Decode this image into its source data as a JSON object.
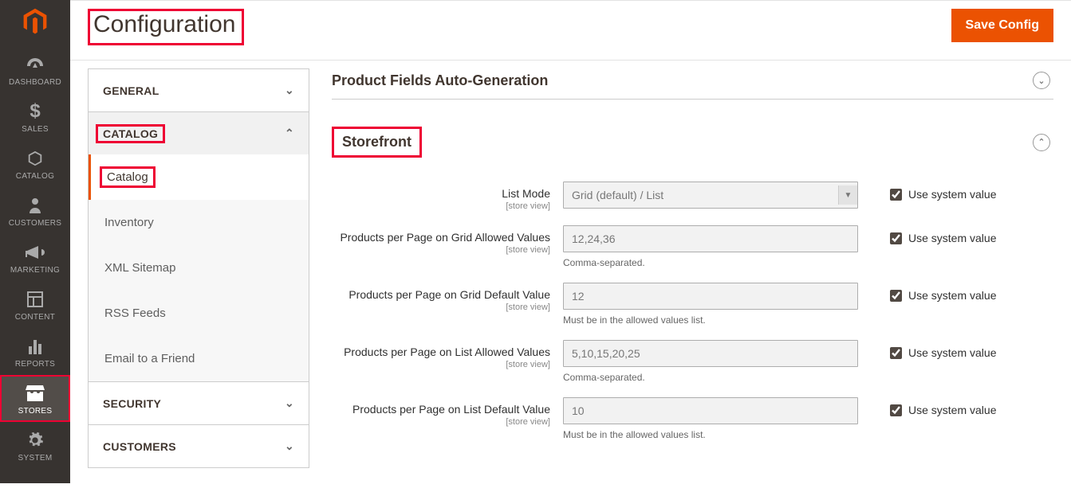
{
  "page": {
    "title": "Configuration",
    "save_label": "Save Config"
  },
  "admin_nav": {
    "items": [
      {
        "label": "DASHBOARD",
        "icon": "gauge"
      },
      {
        "label": "SALES",
        "icon": "dollar"
      },
      {
        "label": "CATALOG",
        "icon": "cube"
      },
      {
        "label": "CUSTOMERS",
        "icon": "person"
      },
      {
        "label": "MARKETING",
        "icon": "megaphone"
      },
      {
        "label": "CONTENT",
        "icon": "layout"
      },
      {
        "label": "REPORTS",
        "icon": "bars"
      },
      {
        "label": "STORES",
        "icon": "store"
      },
      {
        "label": "SYSTEM",
        "icon": "gear"
      }
    ]
  },
  "config_nav": {
    "sections": {
      "general": {
        "label": "GENERAL"
      },
      "catalog": {
        "label": "CATALOG",
        "items": [
          {
            "label": "Catalog"
          },
          {
            "label": "Inventory"
          },
          {
            "label": "XML Sitemap"
          },
          {
            "label": "RSS Feeds"
          },
          {
            "label": "Email to a Friend"
          }
        ]
      },
      "security": {
        "label": "SECURITY"
      },
      "customers": {
        "label": "CUSTOMERS"
      }
    }
  },
  "fieldsets": {
    "product_fields": {
      "title": "Product Fields Auto-Generation"
    },
    "storefront": {
      "title": "Storefront",
      "fields": {
        "list_mode": {
          "label": "List Mode",
          "scope": "[store view]",
          "value": "Grid (default) / List",
          "sys_label": "Use system value"
        },
        "grid_allowed": {
          "label": "Products per Page on Grid Allowed Values",
          "scope": "[store view]",
          "value": "12,24,36",
          "note": "Comma-separated.",
          "sys_label": "Use system value"
        },
        "grid_default": {
          "label": "Products per Page on Grid Default Value",
          "scope": "[store view]",
          "value": "12",
          "note": "Must be in the allowed values list.",
          "sys_label": "Use system value"
        },
        "list_allowed": {
          "label": "Products per Page on List Allowed Values",
          "scope": "[store view]",
          "value": "5,10,15,20,25",
          "note": "Comma-separated.",
          "sys_label": "Use system value"
        },
        "list_default": {
          "label": "Products per Page on List Default Value",
          "scope": "[store view]",
          "value": "10",
          "note": "Must be in the allowed values list.",
          "sys_label": "Use system value"
        }
      }
    }
  }
}
